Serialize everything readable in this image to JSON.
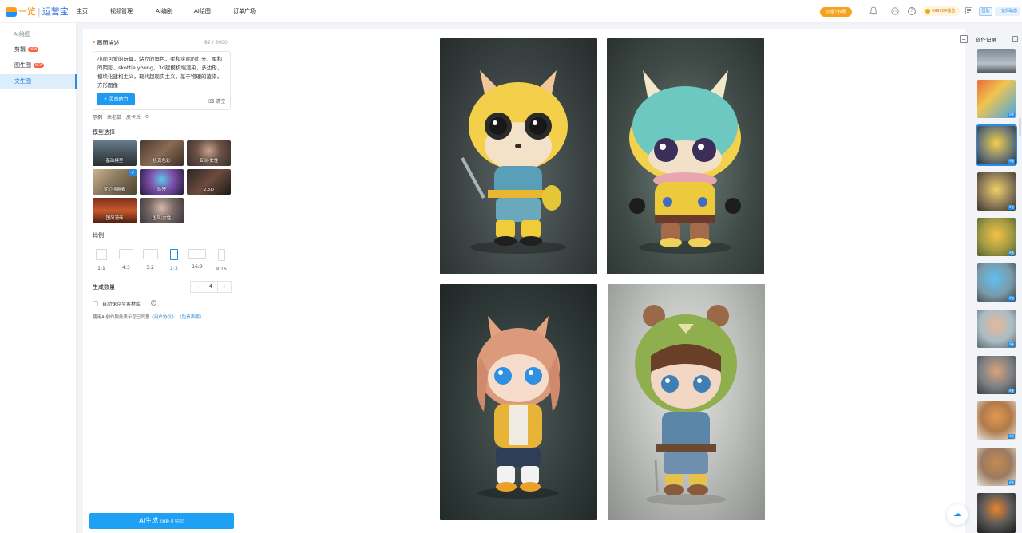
{
  "header": {
    "logo_part1": "一览",
    "logo_separator": "|",
    "logo_part2": "运营宝",
    "nav": [
      "主页",
      "视频管理",
      "AI编剧",
      "AI绘图",
      "订单广场"
    ],
    "vip_label": "办理个权限",
    "help_icon": "?",
    "coin_label": "999984储值",
    "team_tag": "团队",
    "notice_text": "一览师助您"
  },
  "sidebar": {
    "heading": "AI绘图",
    "items": [
      {
        "label": "剪辑",
        "badge": "NEW"
      },
      {
        "label": "图生图",
        "badge": "NEW"
      },
      {
        "label": "文生图",
        "badge": ""
      }
    ]
  },
  "panel": {
    "prompt_label": "画面描述",
    "required_mark": "*",
    "char_count": "82 / 3000",
    "prompt_text": "小而可爱的玩具，站立的角色，柔和实际的灯光，柔和的阴影，skottie young，3d建模机端渲染，多边形，模块化建构主义，现代超现实主义，基于物理的渲染，方形图像",
    "assist_label": "灵感助力",
    "clear_label": "清空",
    "examples_head": "示例",
    "examples": [
      "米老鼠",
      "皮卡丘"
    ],
    "model_label": "模型选择",
    "models": [
      {
        "label": "基础模型"
      },
      {
        "label": "极真色彩"
      },
      {
        "label": "亚洲·女性"
      },
      {
        "label": "梦幻插画者"
      },
      {
        "label": "动漫"
      },
      {
        "label": "2.5D"
      },
      {
        "label": "国风漫画"
      },
      {
        "label": "国风·女性"
      }
    ],
    "ratio_label": "比例",
    "ratios": [
      "1:1",
      "4:3",
      "3:2",
      "2:3",
      "16:9",
      "9:16"
    ],
    "selected_ratio": "2:3",
    "count_label": "生成数量",
    "count_minus": "−",
    "count_value": "4",
    "count_plus": "+",
    "autosave_label": "自动保存至素材库",
    "agree_prefix": "使用AI创作服务表示您已同意",
    "agree_link1": "《用户协议》",
    "agree_link2": "《免责声明》",
    "generate_label": "AI生成",
    "generate_cost": "(消耗 8 钻石)"
  },
  "gallery": {
    "image_count": 4
  },
  "records": {
    "title": "创作记录",
    "thumb_tag": "4张",
    "thumbs": 10
  },
  "colors": {
    "accent": "#1e9bf0",
    "orange": "#f6a21a"
  }
}
